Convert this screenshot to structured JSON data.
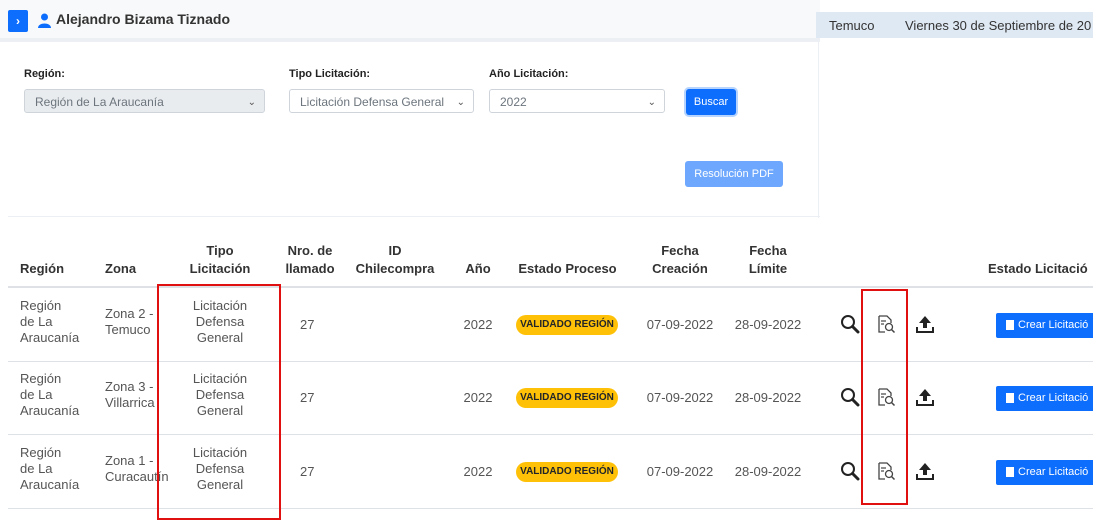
{
  "header": {
    "user_name": "Alejandro Bizama Tiznado",
    "city": "Temuco",
    "date": "Viernes 30 de Septiembre de 20"
  },
  "filters": {
    "region_label": "Región:",
    "region_value": "Región de La Araucanía",
    "tipo_label": "Tipo Licitación:",
    "tipo_value": "Licitación Defensa General",
    "anio_label": "Año Licitación:",
    "anio_value": "2022",
    "buscar_label": "Buscar",
    "pdf_label": "Resolución PDF"
  },
  "table": {
    "headers": {
      "region": "Región",
      "zona": "Zona",
      "tipo_1": "Tipo",
      "tipo_2": "Licitación",
      "nro_1": "Nro. de",
      "nro_2": "llamado",
      "id_1": "ID",
      "id_2": "Chilecompra",
      "anio": "Año",
      "estado": "Estado Proceso",
      "fcrea_1": "Fecha",
      "fcrea_2": "Creación",
      "flim_1": "Fecha",
      "flim_2": "Límite",
      "estado_lic": "Estado Licitació"
    },
    "rows": [
      {
        "region": [
          "Región",
          "de La",
          "Araucanía"
        ],
        "zona": [
          "Zona 2 -",
          "Temuco"
        ],
        "tipo": [
          "Licitación",
          "Defensa",
          "General"
        ],
        "nro": "27",
        "id": "",
        "anio": "2022",
        "estado": "VALIDADO REGIÓN",
        "fcrea": "07-09-2022",
        "flim": "28-09-2022",
        "action": "Crear Licitació"
      },
      {
        "region": [
          "Región",
          "de La",
          "Araucanía"
        ],
        "zona": [
          "Zona 3 -",
          "Villarrica"
        ],
        "tipo": [
          "Licitación",
          "Defensa",
          "General"
        ],
        "nro": "27",
        "id": "",
        "anio": "2022",
        "estado": "VALIDADO REGIÓN",
        "fcrea": "07-09-2022",
        "flim": "28-09-2022",
        "action": "Crear Licitació"
      },
      {
        "region": [
          "Región",
          "de La",
          "Araucanía"
        ],
        "zona": [
          "Zona 1 -",
          "Curacautín"
        ],
        "tipo": [
          "Licitación",
          "Defensa",
          "General"
        ],
        "nro": "27",
        "id": "",
        "anio": "2022",
        "estado": "VALIDADO REGIÓN",
        "fcrea": "07-09-2022",
        "flim": "28-09-2022",
        "action": "Crear Licitació"
      }
    ]
  },
  "colors": {
    "accent": "#0d6efd",
    "badge": "#ffc107",
    "highlight": "#e01010"
  },
  "icons": [
    "sidebar-toggle-icon",
    "user-icon",
    "chevron-down-icon",
    "search-icon",
    "document-search-icon",
    "upload-icon",
    "document-icon"
  ]
}
